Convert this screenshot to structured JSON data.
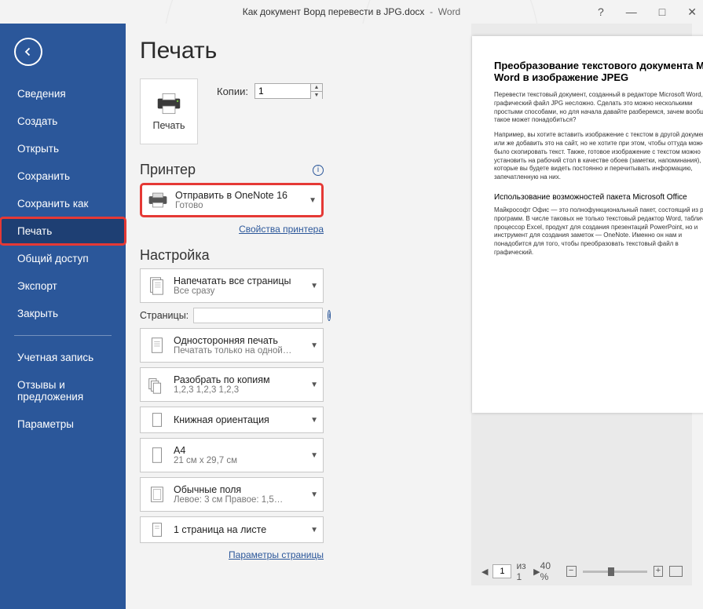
{
  "window": {
    "doc_title": "Как документ Ворд перевести в JPG.docx",
    "app_name": "Word",
    "help": "?",
    "minimize": "—",
    "maximize": "□",
    "close": "✕"
  },
  "sidebar": {
    "items": [
      {
        "label": "Сведения"
      },
      {
        "label": "Создать"
      },
      {
        "label": "Открыть"
      },
      {
        "label": "Сохранить"
      },
      {
        "label": "Сохранить как"
      },
      {
        "label": "Печать"
      },
      {
        "label": "Общий доступ"
      },
      {
        "label": "Экспорт"
      },
      {
        "label": "Закрыть"
      }
    ],
    "items2": [
      {
        "label": "Учетная запись"
      },
      {
        "label": "Отзывы и предложения"
      },
      {
        "label": "Параметры"
      }
    ]
  },
  "content": {
    "title": "Печать",
    "print_button": "Печать",
    "copies_label": "Копии:",
    "copies_value": "1",
    "printer_section": "Принтер",
    "printer": {
      "name": "Отправить в OneNote 16",
      "status": "Готово"
    },
    "printer_props": "Свойства принтера",
    "settings_section": "Настройка",
    "setting_allpages": {
      "line1": "Напечатать все страницы",
      "line2": "Все сразу"
    },
    "pages_label": "Страницы:",
    "pages_value": "",
    "setting_sides": {
      "line1": "Односторонняя печать",
      "line2": "Печатать только на одной…"
    },
    "setting_collate": {
      "line1": "Разобрать по копиям",
      "line2": "1,2,3    1,2,3    1,2,3"
    },
    "setting_orient": {
      "line1": "Книжная ориентация",
      "line2": ""
    },
    "setting_paper": {
      "line1": "A4",
      "line2": "21 см x 29,7 см"
    },
    "setting_margins": {
      "line1": "Обычные поля",
      "line2": "Левое:  3 см   Правое:  1,5…"
    },
    "setting_perpage": {
      "line1": "1 страница на листе",
      "line2": ""
    },
    "page_setup": "Параметры страницы"
  },
  "preview": {
    "doc_heading": "Преобразование текстового документа MS Word в изображение JPEG",
    "p1": "Перевести текстовый документ, созданный в редакторе Microsoft Word, в графический файл JPG несложно. Сделать это можно несколькими простыми способами, но для начала давайте разберемся, зачем вообще такое может понадобиться?",
    "p2": "Например, вы хотите вставить изображение с текстом в другой документ или же добавить это на сайт, но не хотите при этом, чтобы оттуда можно было скопировать текст. Также, готовое изображение с текстом можно установить на рабочий стол в качестве обоев (заметки, напоминания), которые вы будете видеть постоянно и перечитывать информацию, запечатленную на них.",
    "h3": "Использование возможностей пакета Microsoft Office",
    "p3": "Майкрософт Офис — это полнофункциональный пакет, состоящий из ряда программ. В числе таковых не только текстовый редактор Word, табличный процессор Excel, продукт для создания презентаций PowerPoint, но и инструмент для создания заметок — OneNote. Именно он нам и понадобится для того, чтобы преобразовать текстовый файл в графический.",
    "page_current": "1",
    "page_total": "из 1",
    "zoom": "40 %"
  }
}
